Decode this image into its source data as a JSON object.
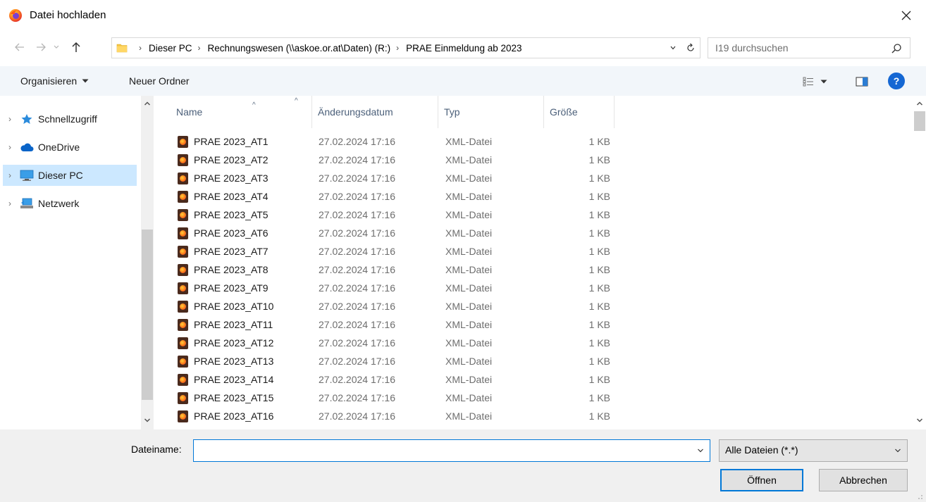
{
  "window": {
    "title": "Datei hochladen"
  },
  "address": {
    "crumbs": [
      "Dieser PC",
      "Rechnungswesen (\\\\askoe.or.at\\Daten) (R:)",
      "PRAE Einmeldung ab 2023"
    ]
  },
  "search": {
    "placeholder": "I19 durchsuchen"
  },
  "toolbar": {
    "organize_label": "Organisieren",
    "new_folder_label": "Neuer Ordner",
    "help_label": "?"
  },
  "nav": {
    "items": [
      {
        "label": "Schnellzugriff",
        "icon": "star-icon"
      },
      {
        "label": "OneDrive",
        "icon": "cloud-icon"
      },
      {
        "label": "Dieser PC",
        "icon": "computer-icon",
        "selected": true
      },
      {
        "label": "Netzwerk",
        "icon": "network-icon"
      }
    ]
  },
  "list": {
    "columns": {
      "name": "Name",
      "date": "Änderungsdatum",
      "type": "Typ",
      "size": "Größe"
    },
    "rows": [
      {
        "name": "PRAE 2023_AT1",
        "date": "27.02.2024 17:16",
        "type": "XML-Datei",
        "size": "1 KB"
      },
      {
        "name": "PRAE 2023_AT2",
        "date": "27.02.2024 17:16",
        "type": "XML-Datei",
        "size": "1 KB"
      },
      {
        "name": "PRAE 2023_AT3",
        "date": "27.02.2024 17:16",
        "type": "XML-Datei",
        "size": "1 KB"
      },
      {
        "name": "PRAE 2023_AT4",
        "date": "27.02.2024 17:16",
        "type": "XML-Datei",
        "size": "1 KB"
      },
      {
        "name": "PRAE 2023_AT5",
        "date": "27.02.2024 17:16",
        "type": "XML-Datei",
        "size": "1 KB"
      },
      {
        "name": "PRAE 2023_AT6",
        "date": "27.02.2024 17:16",
        "type": "XML-Datei",
        "size": "1 KB"
      },
      {
        "name": "PRAE 2023_AT7",
        "date": "27.02.2024 17:16",
        "type": "XML-Datei",
        "size": "1 KB"
      },
      {
        "name": "PRAE 2023_AT8",
        "date": "27.02.2024 17:16",
        "type": "XML-Datei",
        "size": "1 KB"
      },
      {
        "name": "PRAE 2023_AT9",
        "date": "27.02.2024 17:16",
        "type": "XML-Datei",
        "size": "1 KB"
      },
      {
        "name": "PRAE 2023_AT10",
        "date": "27.02.2024 17:16",
        "type": "XML-Datei",
        "size": "1 KB"
      },
      {
        "name": "PRAE 2023_AT11",
        "date": "27.02.2024 17:16",
        "type": "XML-Datei",
        "size": "1 KB"
      },
      {
        "name": "PRAE 2023_AT12",
        "date": "27.02.2024 17:16",
        "type": "XML-Datei",
        "size": "1 KB"
      },
      {
        "name": "PRAE 2023_AT13",
        "date": "27.02.2024 17:16",
        "type": "XML-Datei",
        "size": "1 KB"
      },
      {
        "name": "PRAE 2023_AT14",
        "date": "27.02.2024 17:16",
        "type": "XML-Datei",
        "size": "1 KB"
      },
      {
        "name": "PRAE 2023_AT15",
        "date": "27.02.2024 17:16",
        "type": "XML-Datei",
        "size": "1 KB"
      },
      {
        "name": "PRAE 2023_AT16",
        "date": "27.02.2024 17:16",
        "type": "XML-Datei",
        "size": "1 KB"
      }
    ]
  },
  "bottom": {
    "filename_label": "Dateiname:",
    "filename_value": "",
    "filetype_value": "Alle Dateien (*.*)",
    "open_label": "Öffnen",
    "cancel_label": "Abbrechen"
  },
  "colors": {
    "accent": "#0078d7",
    "selection": "#cce8ff",
    "toolbar_bg": "#f2f6fa",
    "help": "#1567d3"
  }
}
